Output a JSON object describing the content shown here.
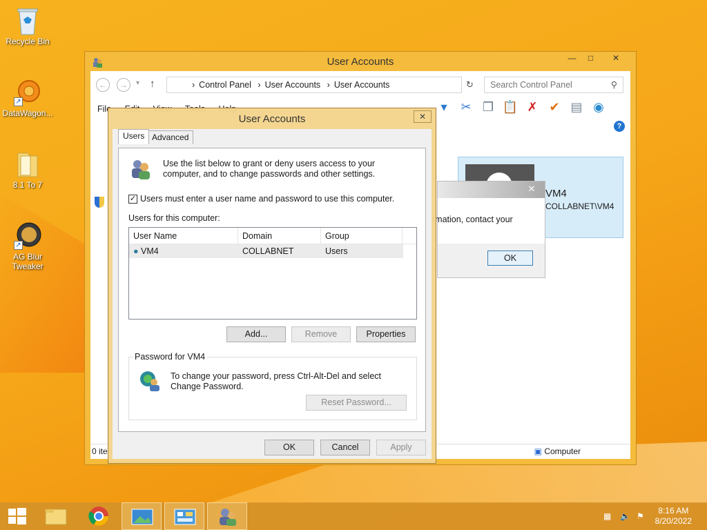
{
  "desktop": {
    "icons": [
      {
        "label": "Recycle Bin"
      },
      {
        "label": "DataWagon..."
      },
      {
        "label": "8.1 To 7"
      },
      {
        "label": "AG Blur Tweaker"
      }
    ]
  },
  "main_window": {
    "title": "User Accounts",
    "breadcrumb": [
      "Control Panel",
      "User Accounts",
      "User Accounts"
    ],
    "search_placeholder": "Search Control Panel",
    "menu": [
      "File",
      "Edit",
      "View",
      "Tools",
      "Help"
    ],
    "user_card": {
      "name": "VM4",
      "domain_user": "COLLABNET\\VM4"
    },
    "status_left": "0 items",
    "status_right": "Computer"
  },
  "message_box": {
    "text": "rmation, contact your",
    "ok_label": "OK"
  },
  "dialog": {
    "title": "User Accounts",
    "tabs": [
      "Users",
      "Advanced"
    ],
    "intro": "Use the list below to grant or deny users access to your computer, and to change passwords and other settings.",
    "checkbox_label": "Users must enter a user name and password to use this computer.",
    "checkbox_checked": true,
    "users_label": "Users for this computer:",
    "columns": [
      "User Name",
      "Domain",
      "Group"
    ],
    "rows": [
      {
        "user": "VM4",
        "domain": "COLLABNET",
        "group": "Users"
      }
    ],
    "add_label": "Add...",
    "remove_label": "Remove",
    "properties_label": "Properties",
    "password_group_title": "Password for VM4",
    "password_text": "To change your password, press Ctrl-Alt-Del and select Change Password.",
    "reset_password_label": "Reset Password...",
    "ok_label": "OK",
    "cancel_label": "Cancel",
    "apply_label": "Apply"
  },
  "taskbar": {
    "time": "8:16 AM",
    "date": "8/20/2022"
  }
}
